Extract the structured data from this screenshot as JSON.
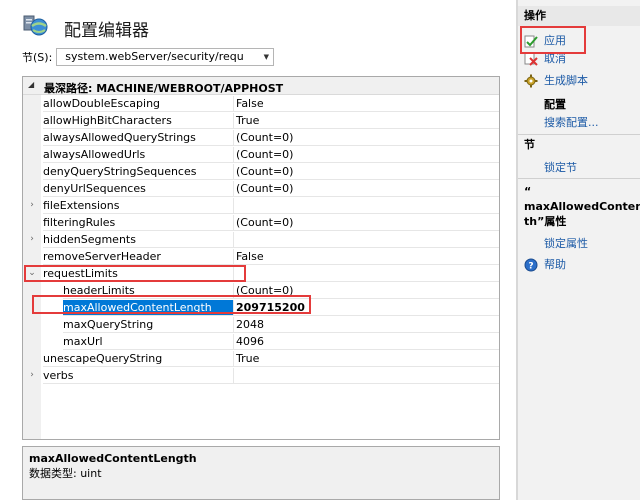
{
  "header": {
    "title": "配置编辑器",
    "icon": "config-editor-icon"
  },
  "section_selector": {
    "label": "节(S):",
    "value": "system.webServer/security/requ"
  },
  "grid": {
    "header": "最深路径: MACHINE/WEBROOT/APPHOST",
    "rows": [
      {
        "name": "allowDoubleEscaping",
        "value": "False",
        "level": 0,
        "toggle": ""
      },
      {
        "name": "allowHighBitCharacters",
        "value": "True",
        "level": 0,
        "toggle": ""
      },
      {
        "name": "alwaysAllowedQueryStrings",
        "value": "(Count=0)",
        "level": 0,
        "toggle": ""
      },
      {
        "name": "alwaysAllowedUrls",
        "value": "(Count=0)",
        "level": 0,
        "toggle": ""
      },
      {
        "name": "denyQueryStringSequences",
        "value": "(Count=0)",
        "level": 0,
        "toggle": ""
      },
      {
        "name": "denyUrlSequences",
        "value": "(Count=0)",
        "level": 0,
        "toggle": ""
      },
      {
        "name": "fileExtensions",
        "value": "",
        "level": 0,
        "toggle": "›"
      },
      {
        "name": "filteringRules",
        "value": "(Count=0)",
        "level": 0,
        "toggle": ""
      },
      {
        "name": "hiddenSegments",
        "value": "",
        "level": 0,
        "toggle": "›"
      },
      {
        "name": "removeServerHeader",
        "value": "False",
        "level": 0,
        "toggle": ""
      },
      {
        "name": "requestLimits",
        "value": "",
        "level": 0,
        "toggle": "⌄"
      },
      {
        "name": "headerLimits",
        "value": "(Count=0)",
        "level": 1,
        "toggle": ""
      },
      {
        "name": "maxAllowedContentLength",
        "value": "209715200",
        "level": 1,
        "toggle": "",
        "selected": true
      },
      {
        "name": "maxQueryString",
        "value": "2048",
        "level": 1,
        "toggle": ""
      },
      {
        "name": "maxUrl",
        "value": "4096",
        "level": 1,
        "toggle": ""
      },
      {
        "name": "unescapeQueryString",
        "value": "True",
        "level": 0,
        "toggle": ""
      },
      {
        "name": "verbs",
        "value": "",
        "level": 0,
        "toggle": "›"
      }
    ]
  },
  "description": {
    "title": "maxAllowedContentLength",
    "type": "数据类型: uint"
  },
  "actions": {
    "heading": "操作",
    "apply": "应用",
    "cancel": "取消",
    "generate_script": "生成脚本",
    "config_label": "配置",
    "search_config": "搜索配置...",
    "section_heading": "节",
    "lock_section": "锁定节",
    "attr_title": "“\nmaxAllowedContentL\nth”属性",
    "lock_attribute": "锁定属性",
    "help": "帮助"
  },
  "colors": {
    "selection": "#0078d7",
    "link": "#1c5aa6",
    "annotation": "#e43b3b"
  }
}
